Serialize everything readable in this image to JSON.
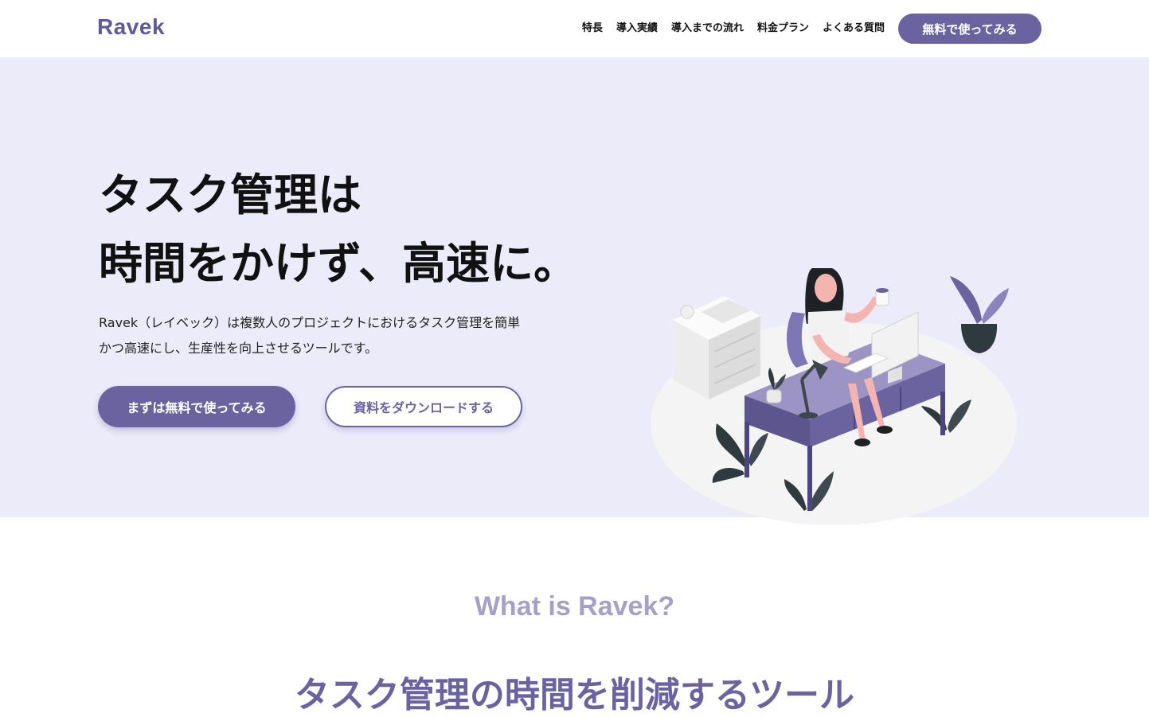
{
  "brand": {
    "name": "Ravek",
    "accent": "#6a63a0",
    "hero_bg": "#ecebfa"
  },
  "nav": {
    "items": [
      "特長",
      "導入実績",
      "導入までの流れ",
      "料金プラン",
      "よくある質問"
    ],
    "cta": "無料で使ってみる"
  },
  "hero": {
    "title_line1": "タスク管理は",
    "title_line2": "時間をかけず、高速に。",
    "desc_line1": "Ravek（レイベック）は複数人のプロジェクトにおけるタスク管理を簡単",
    "desc_line2": "かつ高速にし、生産性を向上させるツールです。",
    "primary_button": "まずは無料で使ってみる",
    "secondary_button": "資料をダウンロードする",
    "illustration_icon": "woman-working-at-desk-illustration"
  },
  "about": {
    "eyebrow": "What is Ravek?",
    "title": "タスク管理の時間を削減するツール"
  }
}
